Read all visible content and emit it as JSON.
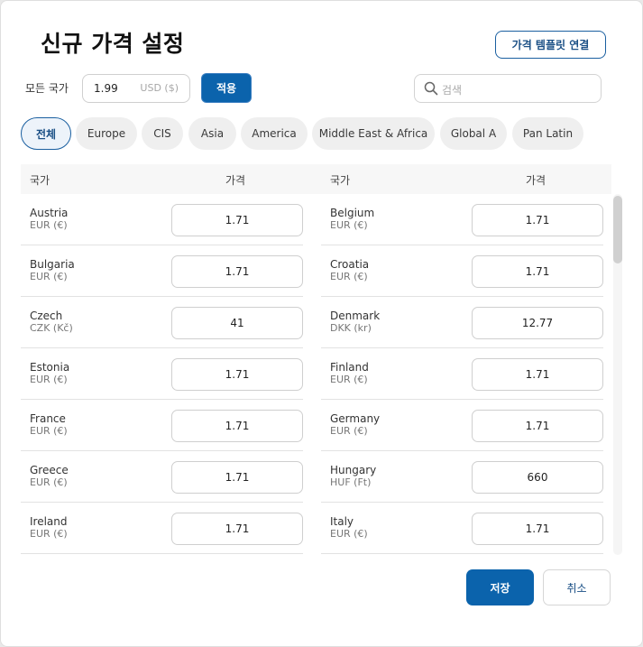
{
  "dialog": {
    "title": "신규 가격 설정",
    "template_button": "가격 템플릿 연결",
    "all_countries_label": "모든 국가",
    "base_price": {
      "value": "1.99",
      "unit": "USD ($)"
    },
    "apply_button": "적용",
    "search": {
      "placeholder": "검색",
      "icon": "search-icon"
    }
  },
  "tabs": [
    {
      "label": "전체",
      "active": true
    },
    {
      "label": "Europe",
      "active": false
    },
    {
      "label": "CIS",
      "active": false
    },
    {
      "label": "Asia",
      "active": false
    },
    {
      "label": "America",
      "active": false
    },
    {
      "label": "Middle East & Africa",
      "active": false
    },
    {
      "label": "Global A",
      "active": false
    },
    {
      "label": "Pan Latin",
      "active": false
    }
  ],
  "table": {
    "headers": {
      "country": "국가",
      "price": "가격"
    },
    "left": [
      {
        "country": "Austria",
        "currency": "EUR (€)",
        "price": "1.71"
      },
      {
        "country": "Bulgaria",
        "currency": "EUR (€)",
        "price": "1.71"
      },
      {
        "country": "Czech",
        "currency": "CZK (Kč)",
        "price": "41"
      },
      {
        "country": "Estonia",
        "currency": "EUR (€)",
        "price": "1.71"
      },
      {
        "country": "France",
        "currency": "EUR (€)",
        "price": "1.71"
      },
      {
        "country": "Greece",
        "currency": "EUR (€)",
        "price": "1.71"
      },
      {
        "country": "Ireland",
        "currency": "EUR (€)",
        "price": "1.71"
      }
    ],
    "right": [
      {
        "country": "Belgium",
        "currency": "EUR (€)",
        "price": "1.71"
      },
      {
        "country": "Croatia",
        "currency": "EUR (€)",
        "price": "1.71"
      },
      {
        "country": "Denmark",
        "currency": "DKK (kr)",
        "price": "12.77"
      },
      {
        "country": "Finland",
        "currency": "EUR (€)",
        "price": "1.71"
      },
      {
        "country": "Germany",
        "currency": "EUR (€)",
        "price": "1.71"
      },
      {
        "country": "Hungary",
        "currency": "HUF (Ft)",
        "price": "660"
      },
      {
        "country": "Italy",
        "currency": "EUR (€)",
        "price": "1.71"
      }
    ]
  },
  "footer": {
    "save_button": "저장",
    "cancel_button": "취소"
  },
  "colors": {
    "primary": "#0b63ac",
    "outline": "#1a5fa0",
    "chip_bg": "#efefef"
  }
}
